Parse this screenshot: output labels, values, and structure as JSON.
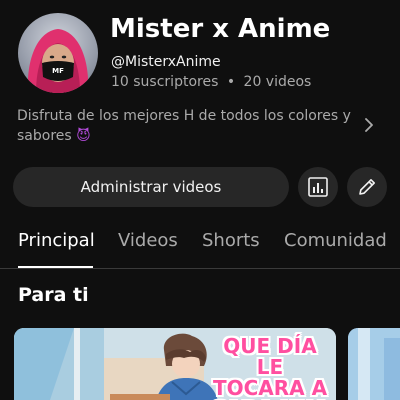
{
  "channel": {
    "name": "Mister x Anime",
    "handle": "@MisterxAnime",
    "subscribers": "10 suscriptores",
    "separator": "•",
    "videos": "20 videos",
    "avatar_mask_text": "MF"
  },
  "description": {
    "text": "Disfruta de los mejores H de todos los colores y sabores",
    "emoji": "😈"
  },
  "actions": {
    "manage_label": "Administrar videos",
    "stats_icon": "bar-chart-icon",
    "edit_icon": "pencil-icon"
  },
  "tabs": [
    {
      "label": "Principal",
      "active": true
    },
    {
      "label": "Videos",
      "active": false
    },
    {
      "label": "Shorts",
      "active": false
    },
    {
      "label": "Comunidad",
      "active": false
    }
  ],
  "section": {
    "title": "Para ti"
  },
  "thumbnails": [
    {
      "caption": "QUE DÍA LE\nTOCARA A\nCADA UNA"
    }
  ],
  "colors": {
    "background": "#0f0f0f",
    "button": "#272727",
    "muted_text": "#aaaaaa",
    "caption_pink": "#ff4fa0"
  }
}
